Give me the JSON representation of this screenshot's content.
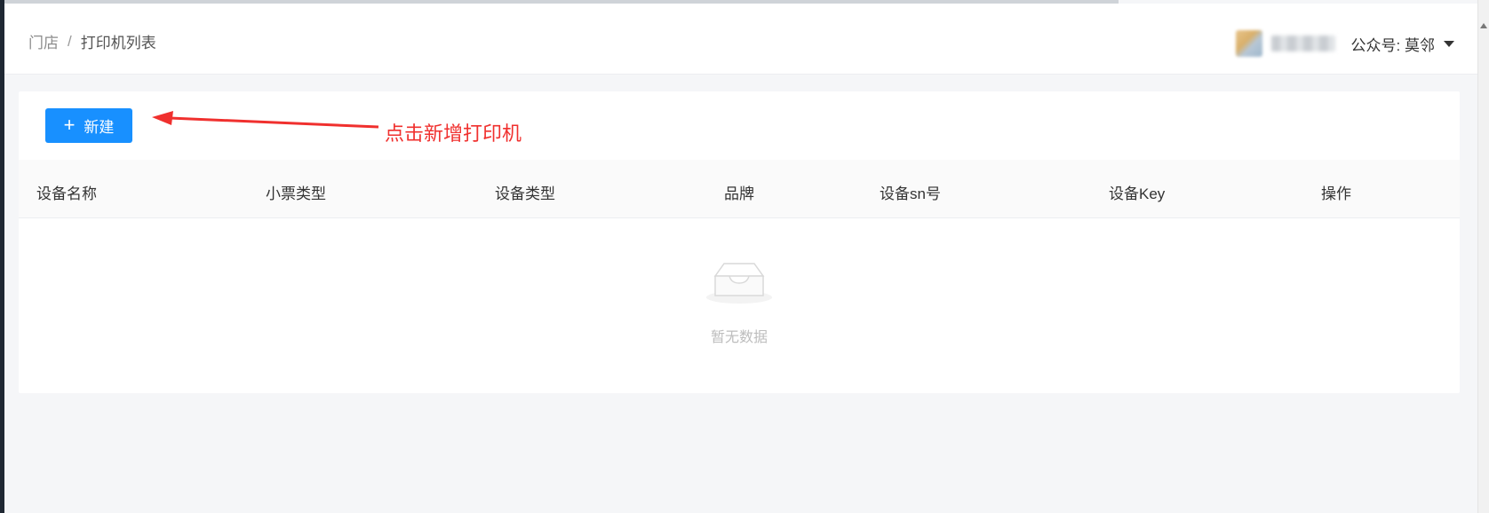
{
  "header": {
    "breadcrumb": [
      "门店",
      "打印机列表"
    ],
    "breadcrumb_separator": "/",
    "account_label": "公众号: 莫邻"
  },
  "toolbar": {
    "new_button_label": "新建",
    "annotation_text": "点击新增打印机",
    "annotation_color": "#f0302e",
    "primary_color": "#1890ff"
  },
  "table": {
    "columns": [
      "设备名称",
      "小票类型",
      "设备类型",
      "品牌",
      "设备sn号",
      "设备Key",
      "操作"
    ],
    "rows": [],
    "empty_text": "暂无数据"
  },
  "icons": [
    "plus-icon",
    "arrow-annotation",
    "empty-inbox-icon",
    "caret-down-icon"
  ]
}
